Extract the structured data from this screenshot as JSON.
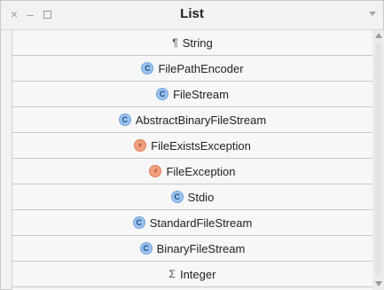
{
  "window": {
    "title": "List",
    "controls": {
      "close": "×",
      "minimize": "–"
    }
  },
  "list": {
    "items": [
      {
        "label": "String",
        "kind": "trait",
        "glyph": "¶"
      },
      {
        "label": "FilePathEncoder",
        "kind": "class",
        "glyph": "C"
      },
      {
        "label": "FileStream",
        "kind": "class",
        "glyph": "C"
      },
      {
        "label": "AbstractBinaryFileStream",
        "kind": "class",
        "glyph": "C"
      },
      {
        "label": "FileExistsException",
        "kind": "exception",
        "glyph": "⚡"
      },
      {
        "label": "FileException",
        "kind": "exception",
        "glyph": "⚡"
      },
      {
        "label": "Stdio",
        "kind": "class",
        "glyph": "C"
      },
      {
        "label": "StandardFileStream",
        "kind": "class",
        "glyph": "C"
      },
      {
        "label": "BinaryFileStream",
        "kind": "class",
        "glyph": "C"
      },
      {
        "label": "Integer",
        "kind": "sum",
        "glyph": "Σ"
      }
    ]
  },
  "colors": {
    "class_badge": "#9cc3ef",
    "exception_badge": "#f1a17f",
    "row_border": "#c7c7c7"
  }
}
